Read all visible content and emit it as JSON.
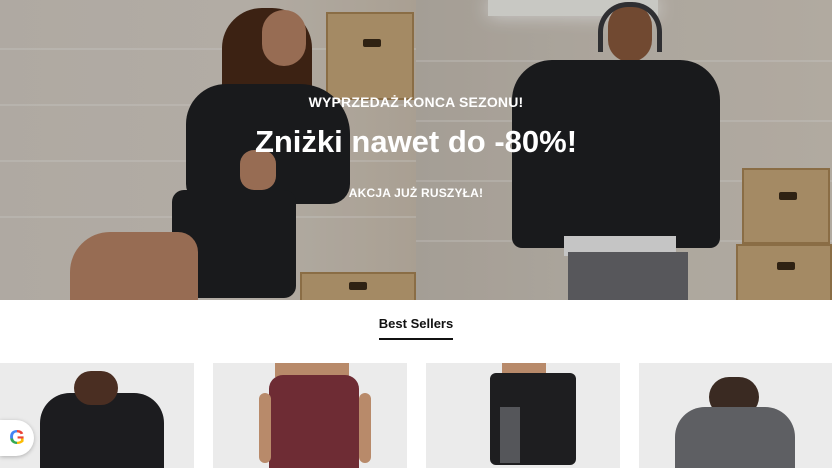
{
  "hero": {
    "eyebrow": "WYPRZEDAŻ KONCA SEZONU!",
    "title": "Zniżki nawet do -80%!",
    "subtitle": "AKCJA JUŻ RUSZYŁA!"
  },
  "best_sellers": {
    "title": "Best Sellers",
    "products": [
      {
        "icon": "black-oversized-tshirt-image"
      },
      {
        "icon": "burgundy-leggings-image"
      },
      {
        "icon": "black-shorts-image"
      },
      {
        "icon": "grey-hoodie-image"
      }
    ]
  },
  "google_badge": {
    "label": "G",
    "icon": "google-icon"
  },
  "colors": {
    "text_dark": "#111111",
    "hero_text": "#ffffff",
    "card_bg": "#ebebeb"
  }
}
